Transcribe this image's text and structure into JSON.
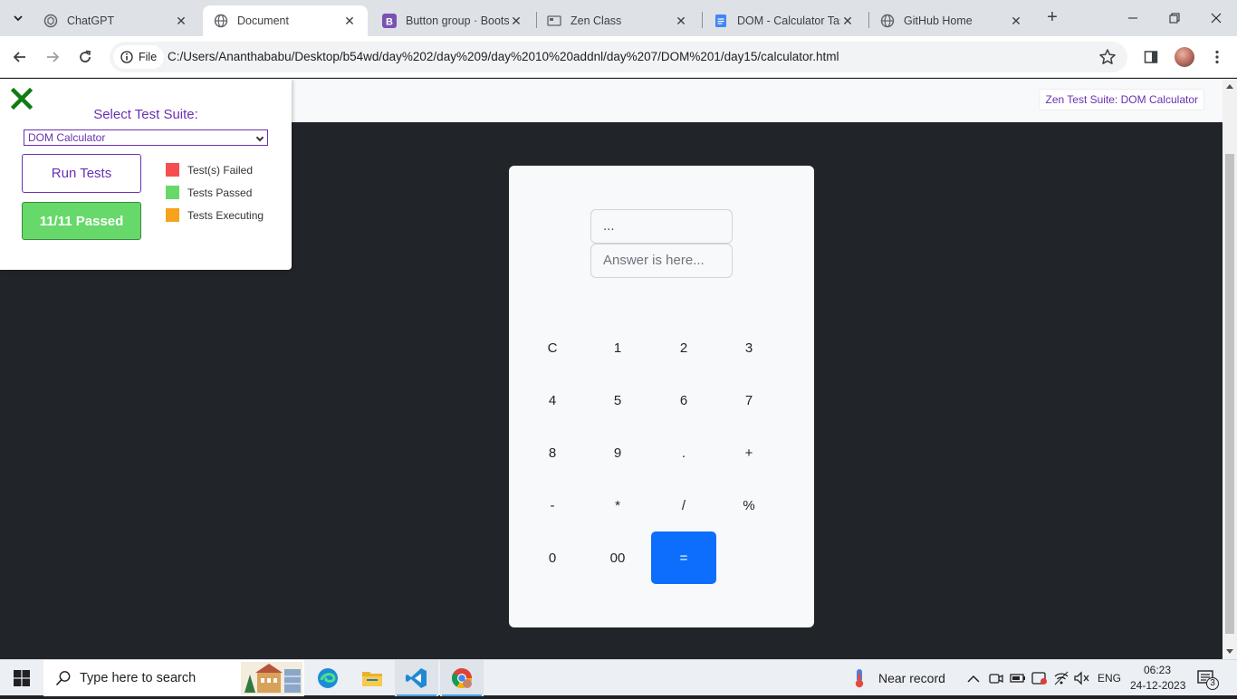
{
  "browser": {
    "tabs": [
      {
        "title": "ChatGPT",
        "active": false
      },
      {
        "title": "Document",
        "active": true
      },
      {
        "title": "Button group · Bootst",
        "active": false
      },
      {
        "title": "Zen Class",
        "active": false
      },
      {
        "title": "DOM - Calculator Tas",
        "active": false
      },
      {
        "title": "GitHub Home",
        "active": false
      }
    ],
    "site_chip": "File",
    "url": "C:/Users/Ananthababu/Desktop/b54wd/day%202/day%209/day%2010%20addnl/day%207/DOM%201/day15/calculator.html"
  },
  "page": {
    "zen_label": "Zen Test Suite: DOM Calculator"
  },
  "test_panel": {
    "title": "Select Test Suite:",
    "selected_suite": "DOM Calculator",
    "run_label": "Run Tests",
    "result_label": "11/11 Passed",
    "legend": [
      {
        "label": "Test(s) Failed",
        "color": "#f54e4e"
      },
      {
        "label": "Tests Passed",
        "color": "#66d96a"
      },
      {
        "label": "Tests Executing",
        "color": "#f7a21b"
      }
    ]
  },
  "calculator": {
    "display_value": "...",
    "answer_placeholder": "Answer is here...",
    "keys": [
      [
        "C",
        "1",
        "2",
        "3"
      ],
      [
        "4",
        "5",
        "6",
        "7"
      ],
      [
        "8",
        "9",
        ".",
        "+"
      ],
      [
        "-",
        "*",
        "/",
        "%"
      ],
      [
        "0",
        "00",
        "="
      ]
    ],
    "primary_color": "#0d6efd"
  },
  "taskbar": {
    "search_placeholder": "Type here to search",
    "weather": "Near record",
    "language": "ENG",
    "time": "06:23",
    "date": "24-12-2023",
    "notification_count": "3"
  }
}
